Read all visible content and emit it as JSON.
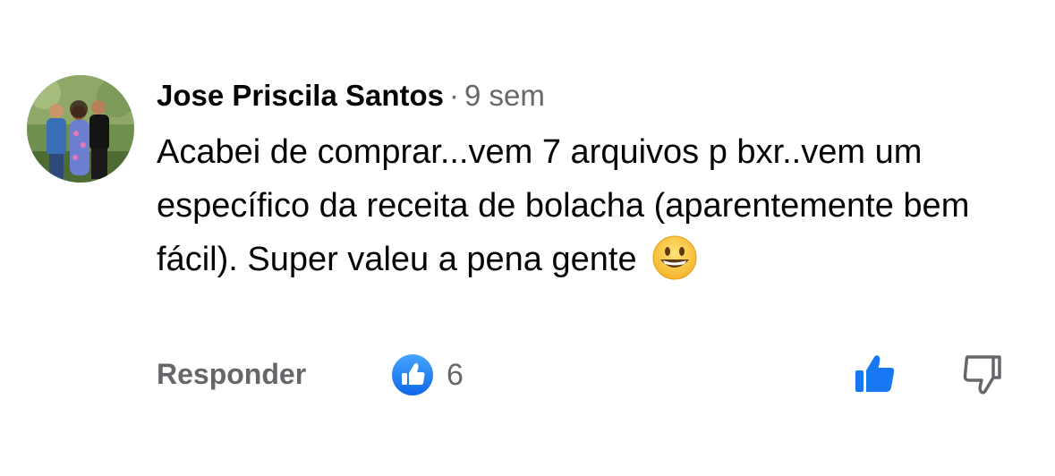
{
  "comment": {
    "author": "Jose Priscila Santos",
    "separator": "·",
    "time": "9 sem",
    "text": "Acabei de comprar...vem 7 arquivos p bxr..vem um específico da receita de bolacha (aparentemente bem fácil). Super valeu a pena gente",
    "emoji": "grinning-face"
  },
  "actions": {
    "reply_label": "Responder",
    "reaction_icon": "like-reaction-icon",
    "reaction_count": "6",
    "like_icon": "thumbs-up-icon",
    "dislike_icon": "thumbs-down-icon"
  },
  "colors": {
    "accent": "#1877f2",
    "secondary_text": "#65676b",
    "primary_text": "#050505"
  }
}
